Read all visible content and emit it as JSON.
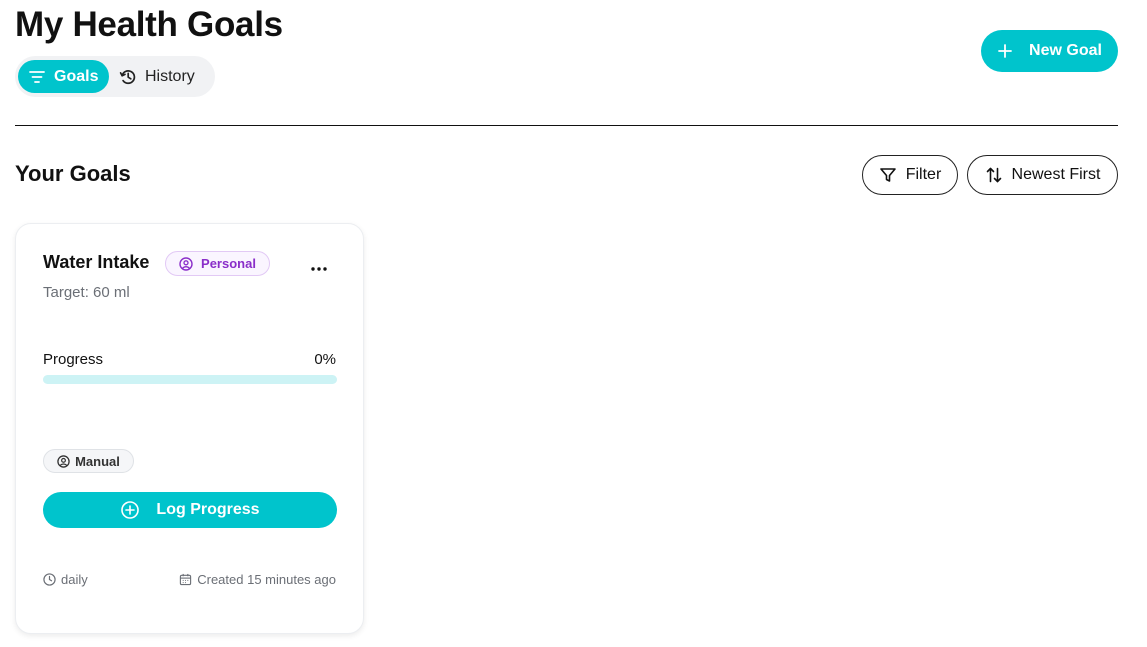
{
  "header": {
    "title": "My Health Goals",
    "new_goal_label": "New Goal"
  },
  "view_toggle": {
    "active_label": "Goals",
    "inactive_label": "History"
  },
  "goals_section": {
    "title": "Your Goals",
    "filter_label": "Filter",
    "sort_label": "Newest First"
  },
  "goal_cards": [
    {
      "title": "Water Intake",
      "category": "Personal",
      "target": "Target: 60 ml",
      "progress_label": "Progress",
      "progress_value": "0%",
      "progress_fraction": 0,
      "source": "Manual",
      "action_label": "Log Progress",
      "frequency": "daily",
      "created": "Created 15 minutes ago"
    }
  ],
  "colors": {
    "accent": "#00c4cc",
    "progress_track": "#cdf3f5",
    "category_badge": "#8a2ec9"
  }
}
